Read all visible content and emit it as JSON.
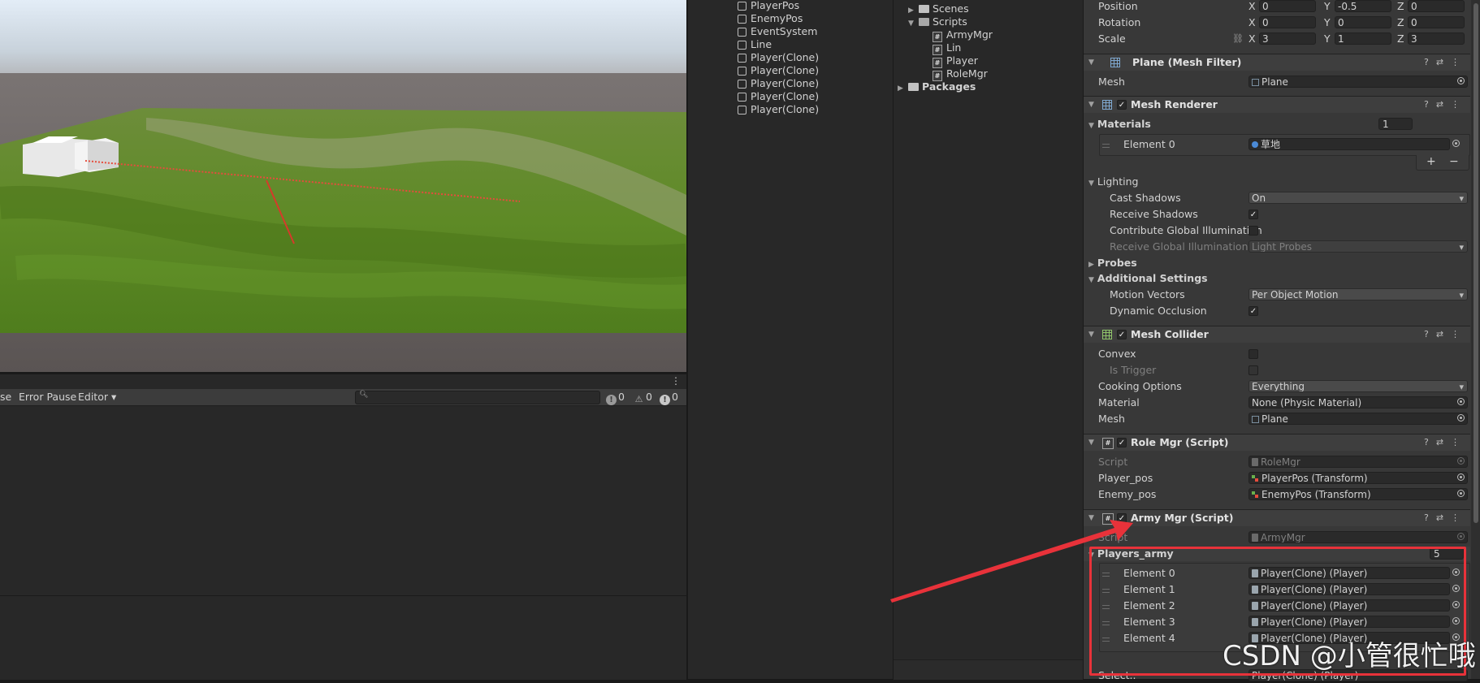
{
  "console": {
    "buttons": [
      "se",
      "Error Pause",
      "Editor ▾"
    ],
    "search": {
      "placeholder": ""
    },
    "counts": {
      "log": "0",
      "warn": "0",
      "error": "0"
    }
  },
  "hierarchy": {
    "items": [
      "PlayerPos",
      "EnemyPos",
      "EventSystem",
      "Line",
      "Player(Clone)",
      "Player(Clone)",
      "Player(Clone)",
      "Player(Clone)",
      "Player(Clone)"
    ]
  },
  "project": {
    "scenes": "Scenes",
    "scripts": "Scripts",
    "script_files": [
      "ArmyMgr",
      "Lin",
      "Player",
      "RoleMgr"
    ],
    "packages": "Packages"
  },
  "transform": {
    "position_label": "Position",
    "position": [
      "0",
      "-0.5",
      "0"
    ],
    "rotation_label": "Rotation",
    "rotation": [
      "0",
      "0",
      "0"
    ],
    "scale_label": "Scale",
    "scale": [
      "3",
      "1",
      "3"
    ],
    "axis": [
      "X",
      "Y",
      "Z"
    ]
  },
  "mesh_filter": {
    "title": "Plane (Mesh Filter)",
    "mesh_label": "Mesh",
    "mesh_value": "Plane"
  },
  "mesh_renderer": {
    "title": "Mesh Renderer",
    "materials_label": "Materials",
    "materials_count": "1",
    "element0_label": "Element 0",
    "element0_value": "草地",
    "lighting_label": "Lighting",
    "cast_shadows_label": "Cast Shadows",
    "cast_shadows_value": "On",
    "receive_shadows_label": "Receive Shadows",
    "contribute_gi_label": "Contribute Global Illumination",
    "receive_gi_label": "Receive Global Illumination",
    "receive_gi_value": "Light Probes",
    "probes_label": "Probes",
    "additional_label": "Additional Settings",
    "motion_vectors_label": "Motion Vectors",
    "motion_vectors_value": "Per Object Motion",
    "dynamic_occlusion_label": "Dynamic Occlusion"
  },
  "mesh_collider": {
    "title": "Mesh Collider",
    "convex_label": "Convex",
    "is_trigger_label": "Is Trigger",
    "cooking_label": "Cooking Options",
    "cooking_value": "Everything",
    "material_label": "Material",
    "material_value": "None (Physic Material)",
    "mesh_label": "Mesh",
    "mesh_value": "Plane"
  },
  "role_mgr": {
    "title": "Role Mgr (Script)",
    "script_label": "Script",
    "script_value": "RoleMgr",
    "player_pos_label": "Player_pos",
    "player_pos_value": "PlayerPos (Transform)",
    "enemy_pos_label": "Enemy_pos",
    "enemy_pos_value": "EnemyPos (Transform)"
  },
  "army_mgr": {
    "title": "Army Mgr (Script)",
    "script_label": "Script",
    "script_value": "ArmyMgr",
    "players_army_label": "Players_army",
    "players_army_count": "5",
    "elements": [
      {
        "label": "Element 0",
        "value": "Player(Clone) (Player)"
      },
      {
        "label": "Element 1",
        "value": "Player(Clone) (Player)"
      },
      {
        "label": "Element 2",
        "value": "Player(Clone) (Player)"
      },
      {
        "label": "Element 3",
        "value": "Player(Clone) (Player)"
      },
      {
        "label": "Element 4",
        "value": "Player(Clone) (Player)"
      }
    ],
    "partial_label": "Select..",
    "partial_value": "Player(Clone) (Player)"
  },
  "overlay": {
    "watermark": "CSDN @小管很忙哦",
    "annotation_color": "#e8323a"
  },
  "colors": {
    "grass": "#5f8a2a",
    "panel": "#383838",
    "background": "#282828"
  }
}
